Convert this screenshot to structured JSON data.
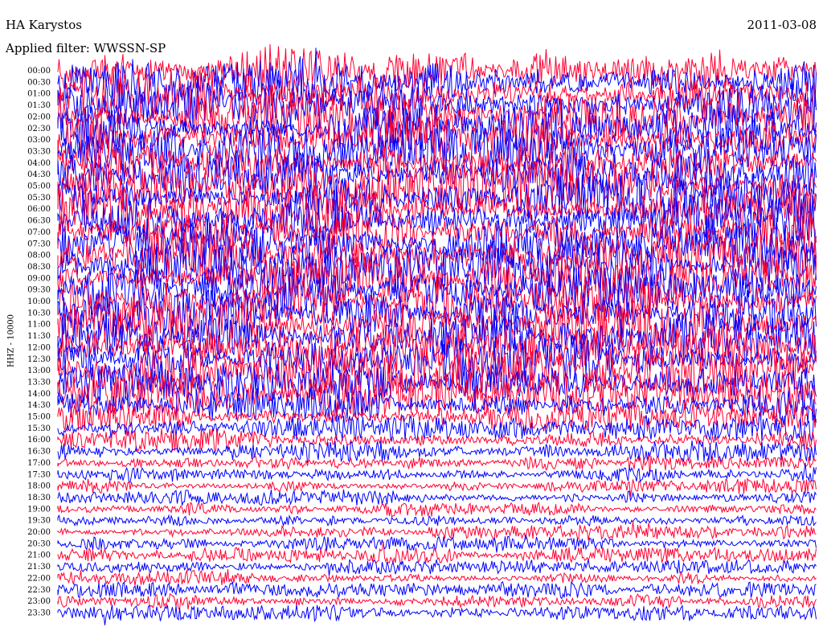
{
  "header": {
    "station": "HA Karystos",
    "date": "2011-03-08",
    "filter": "Applied filter: WWSSN-SP",
    "channel": "HHZ - 10000"
  },
  "chart_data": {
    "type": "line",
    "title": "HA Karystos",
    "subtitle": "Applied filter: WWSSN-SP",
    "ylabel": "HHZ - 10000",
    "xlabel": "",
    "grid": false,
    "legend": "none",
    "colors": [
      "#ff0033",
      "#0000ff"
    ],
    "rows": [
      "00:00",
      "00:30",
      "01:00",
      "01:30",
      "02:00",
      "02:30",
      "03:00",
      "03:30",
      "04:00",
      "04:30",
      "05:00",
      "05:30",
      "06:00",
      "06:30",
      "07:00",
      "07:30",
      "08:00",
      "08:30",
      "09:00",
      "09:30",
      "10:00",
      "10:30",
      "11:00",
      "11:30",
      "12:00",
      "12:30",
      "13:00",
      "13:30",
      "14:00",
      "14:30",
      "15:00",
      "15:30",
      "16:00",
      "16:30",
      "17:00",
      "17:30",
      "18:00",
      "18:30",
      "19:00",
      "19:30",
      "20:00",
      "20:30",
      "21:00",
      "21:30",
      "22:00",
      "22:30",
      "23:00",
      "23:30"
    ],
    "amplitude": [
      1.0,
      1.0,
      1.0,
      1.0,
      1.0,
      1.0,
      1.0,
      1.0,
      1.0,
      1.0,
      1.0,
      1.0,
      1.0,
      1.0,
      1.0,
      1.0,
      1.0,
      1.0,
      1.0,
      1.0,
      1.0,
      1.0,
      1.0,
      1.0,
      1.0,
      1.0,
      1.0,
      0.95,
      0.85,
      0.75,
      0.55,
      0.5,
      0.45,
      0.4,
      0.35,
      0.3,
      0.3,
      0.3,
      0.28,
      0.28,
      0.28,
      0.28,
      0.3,
      0.3,
      0.3,
      0.3,
      0.3,
      0.3
    ]
  }
}
